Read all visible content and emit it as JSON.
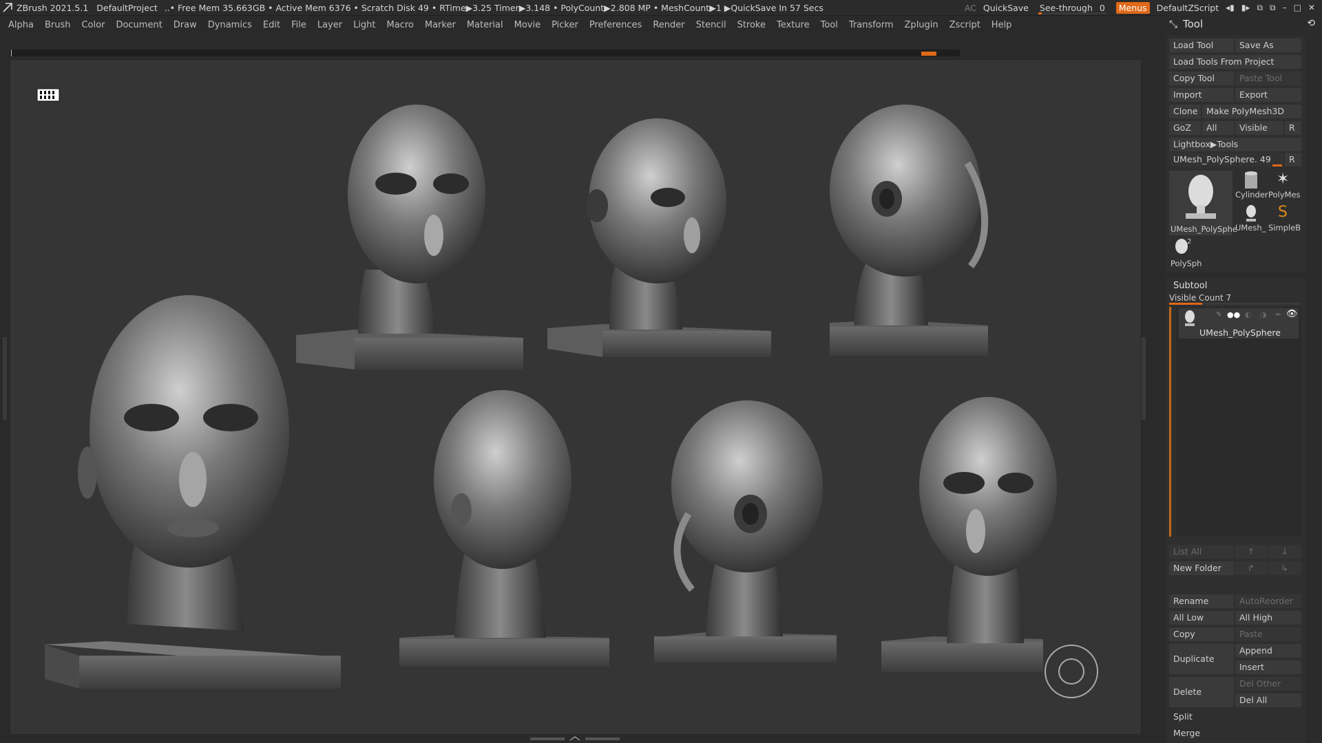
{
  "titlebar": {
    "app": "ZBrush 2021.5.1",
    "project": "DefaultProject",
    "stats": "..• Free Mem 35.663GB • Active Mem 6376 • Scratch Disk 49 • RTime▶3.25 Timer▶3.148 • PolyCount▶2.808 MP • MeshCount▶1 ▶QuickSave In 57 Secs",
    "ac": "AC",
    "quicksave": "QuickSave",
    "seethrough_label": "See-through",
    "seethrough_value": "0",
    "seethrough_level": 0.05,
    "menus": "Menus",
    "script": "DefaultZScript"
  },
  "menubar": [
    "Alpha",
    "Brush",
    "Color",
    "Document",
    "Draw",
    "Dynamics",
    "Edit",
    "File",
    "Layer",
    "Light",
    "Macro",
    "Marker",
    "Material",
    "Movie",
    "Picker",
    "Preferences",
    "Render",
    "Stencil",
    "Stroke",
    "Texture",
    "Tool",
    "Transform",
    "Zplugin",
    "Zscript",
    "Help"
  ],
  "tool": {
    "title": "Tool",
    "load_tool": "Load Tool",
    "save_as": "Save As",
    "load_from_project": "Load Tools From Project",
    "copy_tool": "Copy Tool",
    "paste_tool": "Paste Tool",
    "import": "Import",
    "export": "Export",
    "clone": "Clone",
    "make_polymesh": "Make PolyMesh3D",
    "goz": "GoZ",
    "all": "All",
    "visible": "Visible",
    "r": "R",
    "lightbox": "Lightbox▶Tools",
    "current_tool": "UMesh_PolySphere. 49",
    "thumbs": {
      "main": "UMesh_PolySphe",
      "cylinder": "Cylinder",
      "polymesh": "PolyMes",
      "umesh": "UMesh_",
      "simpleb": "SimpleB",
      "polysph": "PolySph",
      "badge": "2"
    }
  },
  "subtool": {
    "title": "Subtool",
    "visible_count": "Visible Count 7",
    "item_label": "UMesh_PolySphere",
    "list_all": "List All",
    "new_folder": "New Folder",
    "rename": "Rename",
    "autoreorder": "AutoReorder",
    "all_low": "All Low",
    "all_high": "All High",
    "copy": "Copy",
    "paste": "Paste",
    "duplicate": "Duplicate",
    "append": "Append",
    "insert": "Insert",
    "delete": "Delete",
    "del_other": "Del Other",
    "del_all": "Del All",
    "split": "Split",
    "merge": "Merge"
  },
  "colors": {
    "accent": "#e06a18",
    "viewport": "#353535",
    "panel": "#2b2b2b"
  }
}
